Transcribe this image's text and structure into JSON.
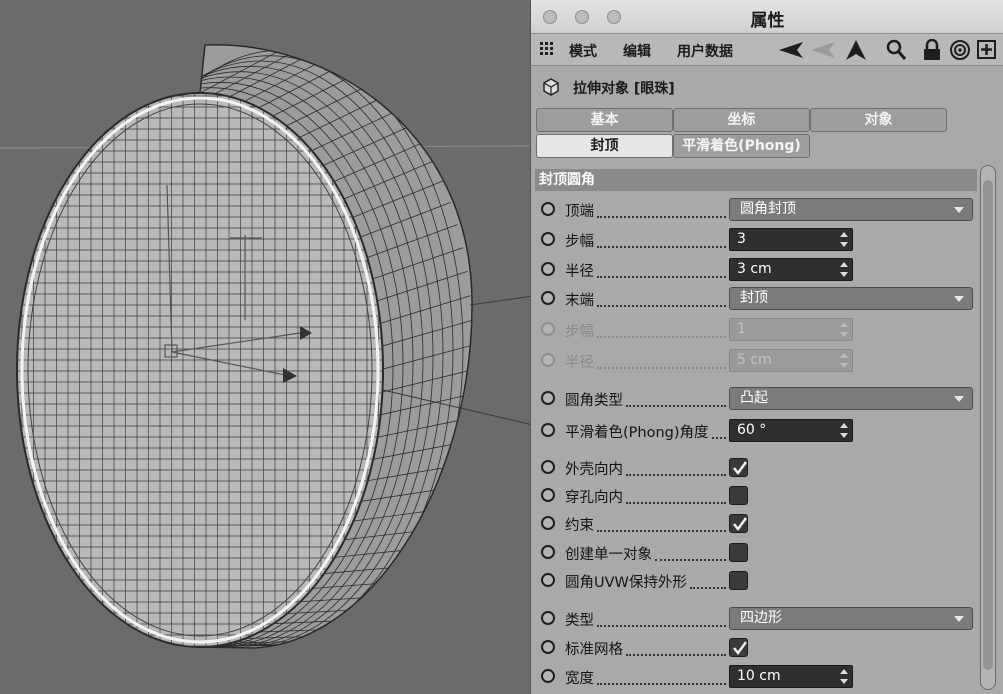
{
  "window": {
    "title": "属性"
  },
  "menu": {
    "items": [
      "模式",
      "编辑",
      "用户数据"
    ]
  },
  "object": {
    "title": "拉伸对象 [眼珠]"
  },
  "tabs": {
    "row1": [
      "基本",
      "坐标",
      "对象"
    ],
    "row2": [
      "封顶",
      "平滑着色(Phong)"
    ],
    "active": "封顶"
  },
  "section": {
    "title": "封顶圆角"
  },
  "properties": [
    {
      "label": "顶端",
      "control": "dropdown",
      "value": "圆角封顶",
      "enabled": true
    },
    {
      "label": "步幅",
      "control": "stepper",
      "value": "3",
      "enabled": true
    },
    {
      "label": "半径",
      "control": "stepper",
      "value": "3 cm",
      "enabled": true
    },
    {
      "label": "末端",
      "control": "dropdown",
      "value": "封顶",
      "enabled": true
    },
    {
      "label": "步幅",
      "control": "stepper",
      "value": "1",
      "enabled": false
    },
    {
      "label": "半径",
      "control": "stepper",
      "value": "5 cm",
      "enabled": false
    },
    {
      "label": "圆角类型",
      "control": "dropdown",
      "value": "凸起",
      "enabled": true
    },
    {
      "label": "平滑着色(Phong)角度",
      "control": "stepper",
      "value": "60 °",
      "enabled": true
    },
    {
      "label": "外壳向内",
      "control": "checkbox",
      "value": true,
      "enabled": true
    },
    {
      "label": "穿孔向内",
      "control": "checkbox",
      "value": false,
      "enabled": true
    },
    {
      "label": "约束",
      "control": "checkbox",
      "value": true,
      "enabled": true
    },
    {
      "label": "创建单一对象",
      "control": "checkbox",
      "value": false,
      "enabled": true
    },
    {
      "label": "圆角UVW保持外形",
      "control": "checkbox",
      "value": false,
      "enabled": true
    },
    {
      "label": "类型",
      "control": "dropdown",
      "value": "四边形",
      "enabled": true
    },
    {
      "label": "标准网格",
      "control": "checkbox",
      "value": true,
      "enabled": true
    },
    {
      "label": "宽度",
      "control": "stepper",
      "value": "10 cm",
      "enabled": true
    }
  ],
  "icons": {
    "toolbar": [
      "grid-menu-icon",
      "back-arrow-icon",
      "up-arrow-icon",
      "search-icon",
      "lock-icon",
      "target-icon",
      "new-panel-icon"
    ],
    "object": "extrude-object-icon"
  },
  "colors": {
    "panel": "#a9a9a9",
    "viewport": "#6b6b6b",
    "field_dark": "#2f2f2f",
    "dropdown": "#7b7b7b"
  }
}
